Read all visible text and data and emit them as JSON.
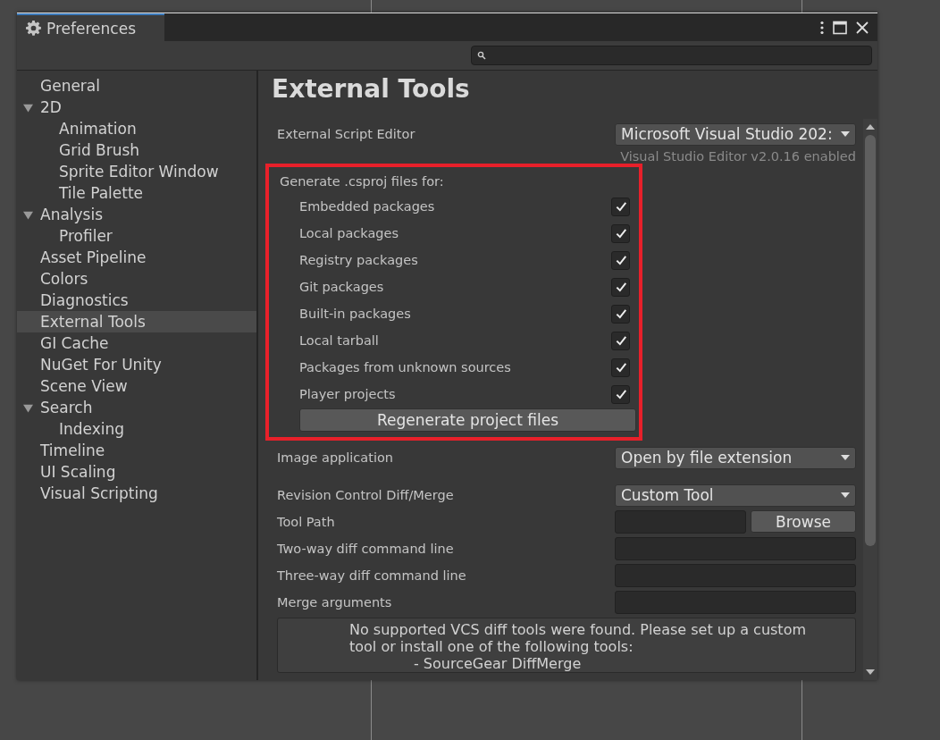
{
  "window": {
    "title": "Preferences"
  },
  "sidebar": {
    "items": [
      {
        "label": "General",
        "selected": false
      },
      {
        "label": "2D",
        "selected": false,
        "expanded": true,
        "children": [
          {
            "label": "Animation",
            "selected": false
          },
          {
            "label": "Grid Brush",
            "selected": false
          },
          {
            "label": "Sprite Editor Window",
            "selected": false
          },
          {
            "label": "Tile Palette",
            "selected": false
          }
        ]
      },
      {
        "label": "Analysis",
        "selected": false,
        "expanded": true,
        "children": [
          {
            "label": "Profiler",
            "selected": false
          }
        ]
      },
      {
        "label": "Asset Pipeline",
        "selected": false
      },
      {
        "label": "Colors",
        "selected": false
      },
      {
        "label": "Diagnostics",
        "selected": false
      },
      {
        "label": "External Tools",
        "selected": true
      },
      {
        "label": "GI Cache",
        "selected": false
      },
      {
        "label": "NuGet For Unity",
        "selected": false
      },
      {
        "label": "Scene View",
        "selected": false
      },
      {
        "label": "Search",
        "selected": false,
        "expanded": true,
        "children": [
          {
            "label": "Indexing",
            "selected": false
          }
        ]
      },
      {
        "label": "Timeline",
        "selected": false
      },
      {
        "label": "UI Scaling",
        "selected": false
      },
      {
        "label": "Visual Scripting",
        "selected": false
      }
    ]
  },
  "page": {
    "title": "External Tools",
    "script_editor": {
      "label": "External Script Editor",
      "value": "Microsoft Visual Studio 202:",
      "note": "Visual Studio Editor v2.0.16 enabled"
    },
    "csproj": {
      "title": "Generate .csproj files for:",
      "highlighted": true,
      "options": [
        {
          "label": "Embedded packages",
          "checked": true
        },
        {
          "label": "Local packages",
          "checked": true
        },
        {
          "label": "Registry packages",
          "checked": true
        },
        {
          "label": "Git packages",
          "checked": true
        },
        {
          "label": "Built-in packages",
          "checked": true
        },
        {
          "label": "Local tarball",
          "checked": true
        },
        {
          "label": "Packages from unknown sources",
          "checked": true
        },
        {
          "label": "Player projects",
          "checked": true
        }
      ],
      "button": "Regenerate project files"
    },
    "image_application": {
      "label": "Image application",
      "value": "Open by file extension"
    },
    "revision_control": {
      "label": "Revision Control Diff/Merge",
      "value": "Custom Tool"
    },
    "tool_path": {
      "label": "Tool Path",
      "button": "Browse"
    },
    "fields": [
      {
        "label": "Two-way diff command line"
      },
      {
        "label": "Three-way diff command line"
      },
      {
        "label": "Merge arguments"
      }
    ],
    "help_lines": [
      "No supported VCS diff tools were found. Please set up a custom",
      "tool or install one of the following tools:",
      "- SourceGear DiffMerge"
    ]
  }
}
